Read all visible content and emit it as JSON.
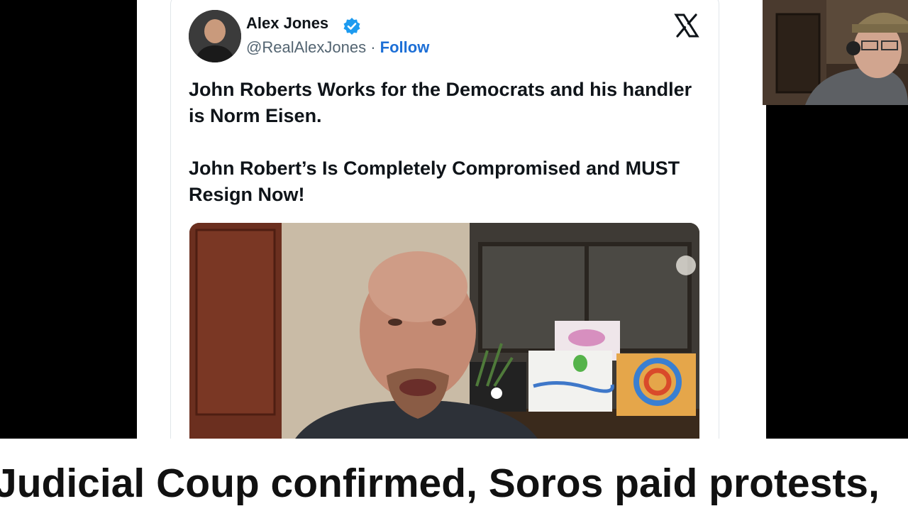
{
  "tweet": {
    "author_name": "Alex Jones",
    "handle": "@RealAlexJones",
    "separator": "·",
    "follow_label": "Follow",
    "paragraphs": [
      "John Roberts Works for the Democrats and his handler is Norm Eisen.",
      "John Robert’s Is Completely Compromised and MUST Resign Now!"
    ]
  },
  "icons": {
    "platform_logo": "x-logo-icon",
    "verified_badge": "verified-badge-icon"
  },
  "caption": {
    "text": "Judicial Coup confirmed, Soros paid protests,"
  },
  "colors": {
    "follow_link": "#1d6fd6",
    "verified_blue": "#1d9bf0",
    "caption_text": "#111111"
  }
}
